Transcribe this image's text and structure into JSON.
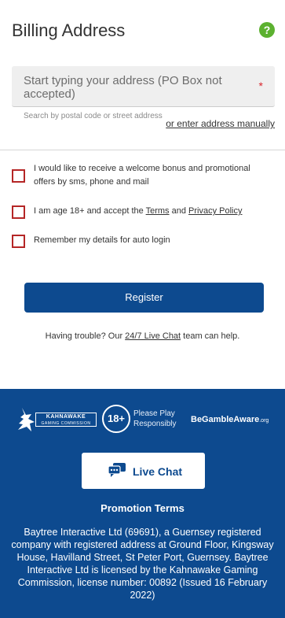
{
  "header": {
    "title": "Billing Address",
    "help_icon": "question-icon"
  },
  "address": {
    "placeholder": "Start typing your address (PO Box not accepted)",
    "required_marker": "*",
    "hint": "Search by postal code or street address",
    "manual_link": "or enter address manually"
  },
  "checkboxes": [
    {
      "label": "I would like to receive a welcome bonus and promotional offers by sms, phone and mail",
      "checked": false
    },
    {
      "label_prefix": "I am age 18+ and accept the ",
      "terms_link": "Terms",
      "label_mid": " and ",
      "privacy_link": "Privacy Policy",
      "checked": false
    },
    {
      "label": "Remember my details for auto login",
      "checked": false
    }
  ],
  "register_button": "Register",
  "trouble": {
    "prefix": "Having trouble? Our ",
    "link": "24/7 Live Chat",
    "suffix": " team can help."
  },
  "footer": {
    "kahnawake_name": "KAHNAWAKE",
    "kahnawake_sub": "GAMING COMMISSION",
    "age_badge": "18+",
    "please_play_line1": "Please Play",
    "please_play_line2": "Responsibly",
    "gamble_aware": "BeGambleAware",
    "gamble_aware_org": ".org",
    "live_chat_button": "Live Chat",
    "promo_title": "Promotion Terms",
    "promo_text": "Baytree Interactive Ltd (69691), a Guernsey registered company with registered address at Ground Floor, Kingsway House, Havilland Street, St Peter Port, Guernsey. Baytree Interactive Ltd is licensed by the Kahnawake Gaming Commission, license number: 00892 (Issued 16 February 2022)"
  },
  "colors": {
    "brand_blue": "#0d4a8f",
    "help_green": "#5cb130",
    "checkbox_red": "#b52626",
    "required_red": "#d9252c"
  }
}
